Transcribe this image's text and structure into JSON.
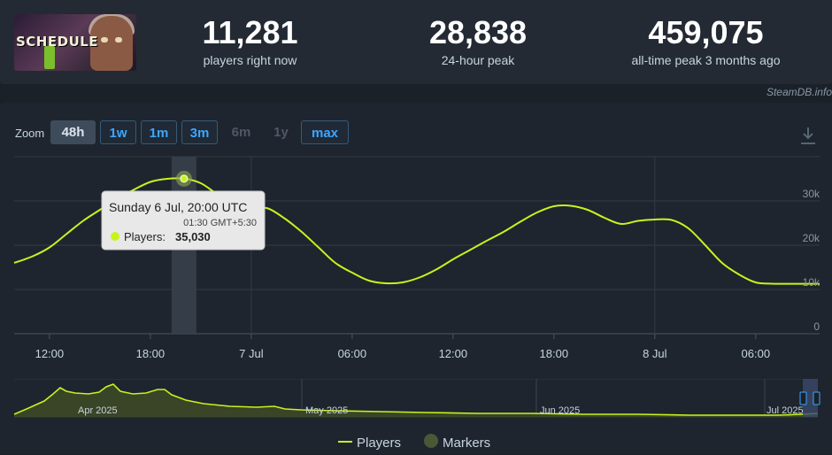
{
  "game": {
    "capsule_text": "SCHEDULE",
    "capsule_digit": "I"
  },
  "stats": [
    {
      "value": "11,281",
      "label": "players right now"
    },
    {
      "value": "28,838",
      "label": "24-hour peak"
    },
    {
      "value": "459,075",
      "label": "all-time peak 3 months ago"
    }
  ],
  "credit": "SteamDB.info",
  "zoom": {
    "label": "Zoom",
    "buttons": [
      {
        "label": "48h",
        "state": "active"
      },
      {
        "label": "1w",
        "state": "enabled"
      },
      {
        "label": "1m",
        "state": "enabled"
      },
      {
        "label": "3m",
        "state": "enabled"
      },
      {
        "label": "6m",
        "state": "disabled"
      },
      {
        "label": "1y",
        "state": "disabled"
      },
      {
        "label": "max",
        "state": "enabled"
      }
    ]
  },
  "icons": {
    "download": "download-icon"
  },
  "colors": {
    "series": "#c8f31d",
    "accent": "#3ea6ff",
    "background": "#1b2129"
  },
  "tooltip": {
    "title": "Sunday 6 Jul, 20:00 UTC",
    "subtitle": "01:30 GMT+5:30",
    "series_label": "Players:",
    "value": "35,030"
  },
  "chart_data": {
    "type": "line",
    "x_unit": "hours since 6 Jul 00:00 UTC",
    "x_ticks": [
      {
        "x": 12,
        "label": "12:00"
      },
      {
        "x": 18,
        "label": "18:00"
      },
      {
        "x": 24,
        "label": "7 Jul"
      },
      {
        "x": 30,
        "label": "06:00"
      },
      {
        "x": 36,
        "label": "12:00"
      },
      {
        "x": 42,
        "label": "18:00"
      },
      {
        "x": 48,
        "label": "8 Jul"
      },
      {
        "x": 54,
        "label": "06:00"
      }
    ],
    "y_ticks": [
      {
        "y": 0,
        "label": "0"
      },
      {
        "y": 10000,
        "label": "10k"
      },
      {
        "y": 20000,
        "label": "20k"
      },
      {
        "y": 30000,
        "label": "30k"
      }
    ],
    "xlim": [
      9.9,
      57.8
    ],
    "ylim": [
      0,
      40000
    ],
    "grid": true,
    "legend_placement": "bottom-center",
    "highlight_x": 20,
    "series": [
      {
        "name": "Players",
        "x": [
          9.9,
          11,
          12,
          13,
          14,
          15,
          16,
          17,
          18,
          19,
          20,
          21,
          22,
          23,
          24,
          25,
          26,
          27,
          28,
          29,
          30,
          31,
          32,
          33,
          34,
          35,
          36,
          37,
          38,
          39,
          40,
          41,
          42,
          43,
          44,
          45,
          46,
          47,
          48,
          49,
          50,
          51,
          52,
          53,
          54,
          55,
          56,
          57,
          57.8
        ],
        "y": [
          16000,
          17500,
          19500,
          22500,
          25500,
          28000,
          30500,
          32500,
          34300,
          35000,
          35030,
          34000,
          31500,
          29500,
          28700,
          28300,
          26000,
          23000,
          19500,
          16000,
          13800,
          12000,
          11400,
          11600,
          12700,
          14500,
          16800,
          18900,
          21000,
          23000,
          25300,
          27400,
          28800,
          28900,
          28000,
          26200,
          24800,
          25500,
          25800,
          25700,
          23800,
          20000,
          16000,
          13400,
          11600,
          11300,
          11281,
          11281,
          11281
        ]
      }
    ]
  },
  "navigator": {
    "month_labels": [
      "Apr 2025",
      "May 2025",
      "Jun 2025",
      "Jul 2025"
    ]
  },
  "legend": {
    "players": "Players",
    "markers": "Markers"
  }
}
